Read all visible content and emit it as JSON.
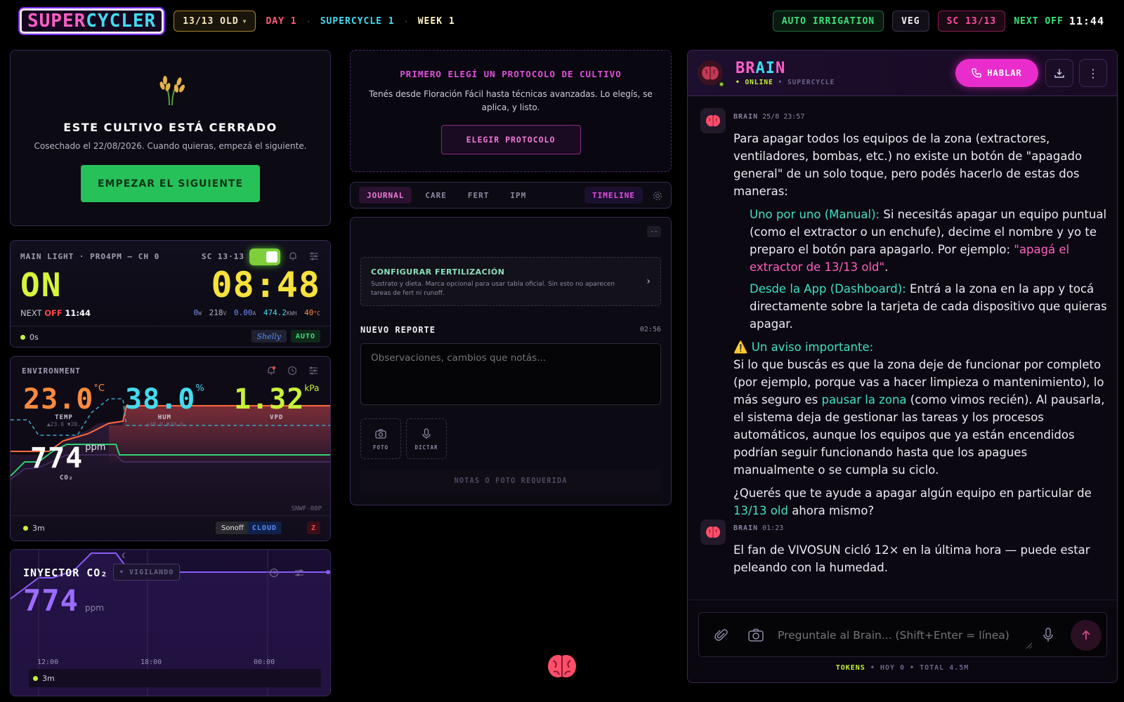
{
  "topbar": {
    "logo_a": "SUPER",
    "logo_b": "CYCLER",
    "zone_select": "13/13 OLD",
    "day": "DAY 1",
    "supercycle": "SUPERCYCLE 1",
    "week": "WEEK 1",
    "auto_irrigation": "AUTO IRRIGATION",
    "veg": "VEG",
    "sc": "SC 13/13",
    "next_off_label": "NEXT OFF",
    "next_off_time": "11:44"
  },
  "closed": {
    "title": "ESTE CULTIVO ESTÁ CERRADO",
    "subtitle": "Cosechado el 22/08/2026. Cuando quieras, empezá el siguiente.",
    "button": "EMPEZAR EL SIGUIENTE"
  },
  "light": {
    "title": "MAIN LIGHT · PRO4PM — CH 0",
    "sc": "SC 13·13",
    "state": "ON",
    "time": "08:48",
    "next_label": "NEXT",
    "off_label": "OFF",
    "next_time": "11:44",
    "watts": "0",
    "watts_u": "W",
    "volts": "218",
    "volts_u": "V",
    "amps": "0.00",
    "amps_u": "A",
    "kwh": "474.2",
    "kwh_u": "KWH",
    "temp": "40",
    "temp_u": "°C",
    "uptime": "0s",
    "brand": "Shelly",
    "mode": "AUTO"
  },
  "env": {
    "title": "ENVIRONMENT",
    "temp": "23.0",
    "temp_u": "°C",
    "temp_label": "TEMP",
    "temp_range": "▲23.0 ▼20.",
    "hum": "38.0",
    "hum_u": "%",
    "hum_label": "HUM",
    "hum_range": "▲40.0 ▼38.0",
    "vpd": "1.32",
    "vpd_u": "kPa",
    "vpd_label": "VPD",
    "co2": "774",
    "co2_u": "ppm",
    "co2_label": "CO₂",
    "device": "SNWF-08P",
    "age": "3m",
    "brand": "Sonoff",
    "cloud": "CLOUD",
    "z": "Z"
  },
  "co2": {
    "title": "INYECTOR CO₂",
    "status": "• VIGILANDO",
    "value": "774",
    "unit": "ppm",
    "ticks": [
      "12:00",
      "18:00",
      "00:00"
    ],
    "age": "3m"
  },
  "protocol": {
    "title": "PRIMERO ELEGÍ UN PROTOCOLO DE CULTIVO",
    "text": "Tenés desde Floración Fácil hasta técnicas avanzadas. Lo elegís, se aplica, y listo.",
    "button": "ELEGIR PROTOCOLO"
  },
  "tabs": {
    "journal": "JOURNAL",
    "care": "CARE",
    "fert": "FERT",
    "ipm": "IPM",
    "timeline": "TIMELINE"
  },
  "report": {
    "collapse": "--",
    "fert_title": "CONFIGURAR FERTILIZACIÓN",
    "fert_text": "Sustrato y dieta. Marca opcional para usar tabla oficial. Sin esto no aparecen tareas de fert ni runoff.",
    "nuevo": "NUEVO REPORTE",
    "time": "02:56",
    "placeholder": "Observaciones, cambios que notás...",
    "foto": "FOTO",
    "dictar": "DICTAR",
    "submit": "NOTAS O FOTO REQUERIDA"
  },
  "chat": {
    "brain_a": "BR",
    "brain_b": "AI",
    "brain_c": "N",
    "online": "• ONLINE",
    "sep": "•",
    "supercycle": "SUPERCYCLE",
    "hablar": "HABLAR",
    "m1_author": "BRAIN",
    "m1_time": "25/8 23:57",
    "m1_p1": "Para apagar todos los equipos de la zona (extractores, ventiladores, bombas, etc.) no existe un botón de \"apagado general\" de un solo toque, pero podés hacerlo de estas dos maneras:",
    "m1_li1_h": "Uno por uno (Manual):",
    "m1_li1_t": " Si necesitás apagar un equipo puntual (como el extractor o un enchufe), decime el nombre y yo te preparo el botón para apagarlo. Por ejemplo: ",
    "m1_li1_q": "\"apagá el extractor de 13/13 old\"",
    "m1_li1_end": ".",
    "m1_li2_h": "Desde la App (Dashboard):",
    "m1_li2_t": " Entrá a la zona en la app y tocá directamente sobre la tarjeta de cada dispositivo que quieras apagar.",
    "m1_warn": "⚠️ Un aviso importante:",
    "m1_p2a": "Si lo que buscás es que la zona deje de funcionar por completo (por ejemplo, porque vas a hacer limpieza o mantenimiento), lo más seguro es ",
    "m1_p2b": "pausar la zona",
    "m1_p2c": " (como vimos recién). Al pausarla, el sistema deja de gestionar las tareas y los procesos automáticos, aunque los equipos que ya están encendidos podrían seguir funcionando hasta que los apagues manualmente o se cumpla su ciclo.",
    "m1_p3a": "¿Querés que te ayude a apagar algún equipo en particular de ",
    "m1_p3b": "13/13 old",
    "m1_p3c": " ahora mismo?",
    "m2_author": "BRAIN",
    "m2_time": "01:23",
    "m2_text": "El fan de VIVOSUN cicló 12× en la última hora — puede estar peleando con la humedad.",
    "input_placeholder": "Preguntale al Brain... (Shift+Enter = línea)",
    "tokens_label": "TOKENS",
    "tokens_info": "• HOY 0 • TOTAL 4.5M"
  },
  "colors": {
    "accent_pink": "#ff4fd8",
    "accent_teal": "#3ee0c3",
    "green": "#27c15a",
    "yellow": "#f7e23c",
    "orange": "#ff8a3d",
    "violet": "#8b5cf6"
  }
}
